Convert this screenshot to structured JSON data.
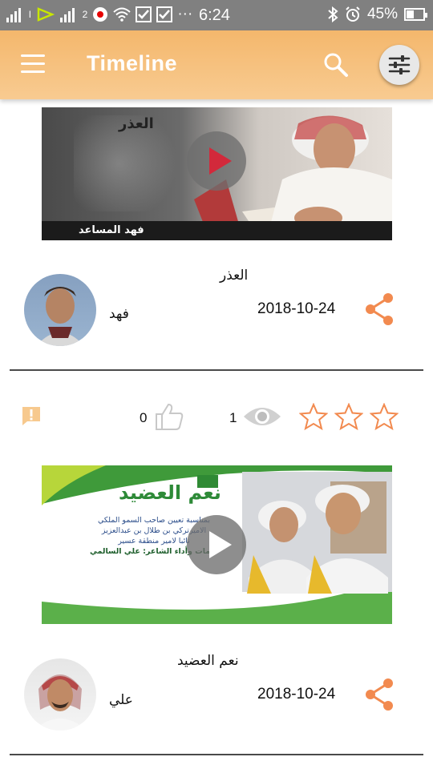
{
  "status_bar": {
    "time": "6:24",
    "battery": "45%",
    "battery_level": 0.45,
    "sim1_label": "l",
    "sim2_label": "2",
    "more_dots": "···"
  },
  "app_bar": {
    "title": "Timeline",
    "background_color": "#f6c07e",
    "accent_color": "#f28a4f",
    "menu_icon": "hamburger-menu-icon",
    "search_icon": "search-icon",
    "filter_icon": "filter-sliders-icon"
  },
  "posts": [
    {
      "thumb_caption_top": "العذر",
      "thumb_caption_bottom": "فهد المساعد",
      "title": "العذر",
      "date": "2018-10-24",
      "author": "فهد",
      "share_icon": "share-icon"
    },
    {
      "thumb_caption_top": "نعم العضيد",
      "thumb_text_lines": [
        "بمناسبة تعيين صاحب السمو الملكي",
        "الاميرتركي بن طلال بن عبدالعزيز",
        "نائبا لامير منطقة عسير",
        "كلمات وأداء الشاعر: علي السالمي"
      ],
      "title": "نعم العضيد",
      "date": "2018-10-24",
      "author": "علي",
      "share_icon": "share-icon"
    }
  ],
  "engagement_bar": {
    "likes": "0",
    "views": "1",
    "rating_stars": 3,
    "rating_value": 0,
    "report_icon": "report-flag-icon",
    "like_icon": "thumbs-up-icon",
    "views_icon": "eye-icon",
    "star_icon": "star-outline-icon"
  }
}
